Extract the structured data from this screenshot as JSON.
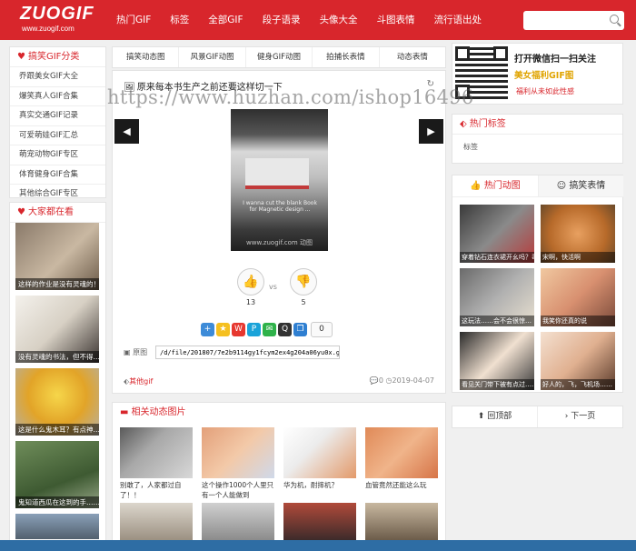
{
  "header": {
    "logo": "ZUOGIF",
    "logo_sub": "www.zuogif.com",
    "nav": [
      "热门GIF",
      "标签",
      "全部GIF",
      "段子语录",
      "头像大全",
      "斗图表情",
      "流行语出处"
    ],
    "search_placeholder": ""
  },
  "sidebar": {
    "title": "搞笑GIF分类",
    "categories": [
      "乔跟美女GIF大全",
      "爆笑真人GIF合集",
      "真实交通GIF记录",
      "可爱萌娃GIF汇总",
      "萌宠动物GIF专区",
      "体育健身GIF合集",
      "其他综合GIF专区"
    ],
    "hot_title": "大家都在看",
    "hot_items": [
      "这样的作业是没有灵魂的！",
      "没有灵魂的书法，但不得……",
      "这是什么鬼木耳？有点神……",
      "鬼知道西瓜在这到的手……",
      ""
    ]
  },
  "tabs": [
    "搞笑动态图",
    "风景GIF动图",
    "健身GIF动图",
    "拍捕长表情",
    "动态表情"
  ],
  "post": {
    "title": "原来每本书生产之前还要这样切一下",
    "image_overlay_text": "www.zuogif.com 动图",
    "image_caption": "I wanna cut the blank Book for Magnetic design ...",
    "like_count": "13",
    "dislike_count": "5",
    "vs": "vs",
    "share_count": "0",
    "url_label": "原图",
    "url_value": "/d/file/201807/7e2b9114gy1fcym2ex4g204a06yu0x.gif",
    "tag": "其他gif",
    "comment_count": "0",
    "date": "2019-04-07"
  },
  "related": {
    "title": "相关动态图片",
    "items": [
      {
        "caption": "别敢了，人家都过自了！！"
      },
      {
        "caption": "这个操作1000个人里只有一个人能做到"
      },
      {
        "caption": "华为机，耐摔机？"
      },
      {
        "caption": "血管竟然还能这么玩"
      }
    ]
  },
  "right": {
    "promo_title": "打开微信扫一扫关注",
    "promo_sub": "美女福利GIF图",
    "promo_note": "福利从未如此性感",
    "hot_tags_title": "热门标签",
    "hot_tag": "标签",
    "tab_hot": "热门动图",
    "tab_funny": "搞笑表情",
    "hot_items": [
      "穿着钻石连衣裙开幺吗？毒…",
      "宋啊，快活啊",
      "这玩法……会不会很惊…",
      "我笑你还真的说",
      "看见关门带下被有点过……",
      "好人的，飞，飞机场……"
    ],
    "back_top": "回顶部",
    "next_page": "下一页"
  },
  "watermark": "https://www.huzhan.com/ishop16496"
}
